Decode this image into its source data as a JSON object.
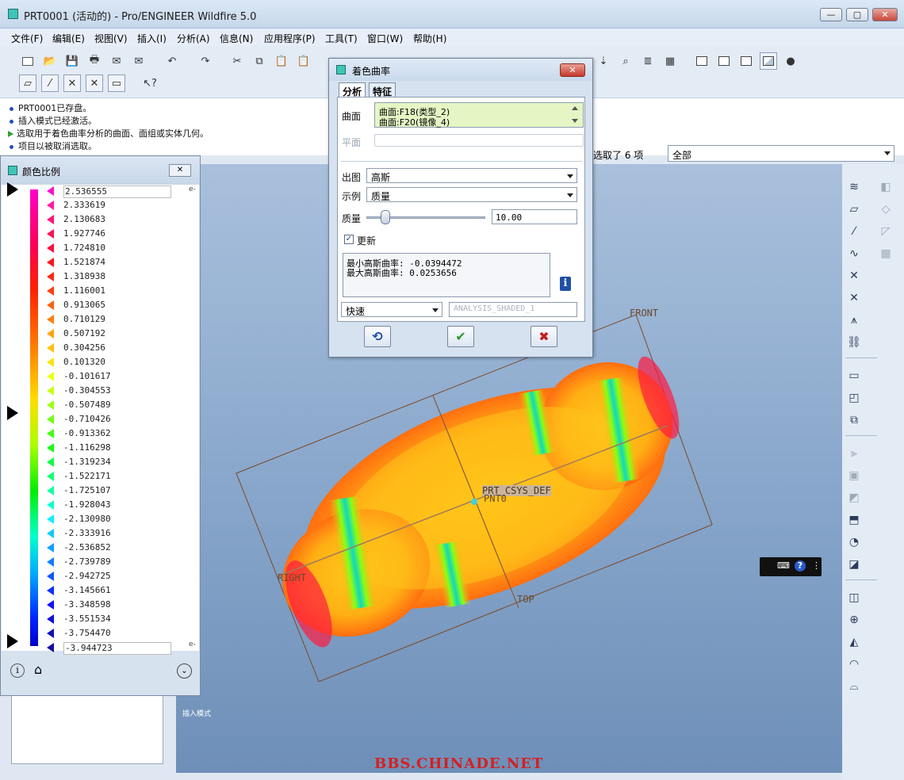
{
  "window": {
    "title": "PRT0001 (活动的) - Pro/ENGINEER Wildfire 5.0",
    "min": "—",
    "max": "▢",
    "close": "✕"
  },
  "menu": [
    "文件(F)",
    "编辑(E)",
    "视图(V)",
    "插入(I)",
    "分析(A)",
    "信息(N)",
    "应用程序(P)",
    "工具(T)",
    "窗口(W)",
    "帮助(H)"
  ],
  "messages": [
    "PRT0001已存盘。",
    "插入模式已经激活。",
    "选取用于着色曲率分析的曲面、面组或实体几何。",
    "项目以被取消选取。"
  ],
  "selection": {
    "label": "选取了 6 项",
    "filter": "全部"
  },
  "scale_window": {
    "title": "颜色比例",
    "exponent_top": "e-",
    "exponent_bottom": "e-",
    "values": [
      "2.536555",
      "2.333619",
      "2.130683",
      "1.927746",
      "1.724810",
      "1.521874",
      "1.318938",
      "1.116001",
      "0.913065",
      "0.710129",
      "0.507192",
      "0.304256",
      "0.101320",
      "-0.101617",
      "-0.304553",
      "-0.507489",
      "-0.710426",
      "-0.913362",
      "-1.116298",
      "-1.319234",
      "-1.522171",
      "-1.725107",
      "-1.928043",
      "-2.130980",
      "-2.333916",
      "-2.536852",
      "-2.739789",
      "-2.942725",
      "-3.145661",
      "-3.348598",
      "-3.551534",
      "-3.754470",
      "-3.944723"
    ],
    "tick_colors": [
      "#ff10c8",
      "#ff1aa0",
      "#ff1478",
      "#ff1050",
      "#ff1038",
      "#ff1520",
      "#ff2a10",
      "#ff4010",
      "#ff6010",
      "#ff8010",
      "#ffa010",
      "#ffc010",
      "#ffe010",
      "#f0ff10",
      "#c8ff10",
      "#a0ff10",
      "#70ff10",
      "#40ff10",
      "#10ff10",
      "#10ff40",
      "#10ff70",
      "#10ffa0",
      "#10ffd0",
      "#10f0ff",
      "#10c8ff",
      "#10a0ff",
      "#1080ff",
      "#1058ff",
      "#1030ff",
      "#1010ff",
      "#1010d8",
      "#1010b8",
      "#1010a0"
    ],
    "foot_info_icon": "i-circle-icon",
    "foot_home_icon": "home-icon",
    "foot_collapse_icon": "chevron-down-circle-icon"
  },
  "dialog": {
    "title": "着色曲率",
    "tabs": [
      "分析",
      "特征"
    ],
    "surface_label": "曲面",
    "surfaces": [
      "曲面:F18(类型_2)",
      "曲面:F20(镜像_4)"
    ],
    "plane_label": "平面",
    "output_label": "出图",
    "output_value": "高斯",
    "display_label": "示例",
    "display_value": "质量",
    "quality_label": "质量",
    "quality_value": "10.00",
    "quality_fraction": 0.1,
    "update_label": "更新",
    "update_checked": "✓",
    "result_lines": [
      "最小高斯曲率: -0.0394472",
      "最大高斯曲率: 0.0253656"
    ],
    "mode_value": "快速",
    "analysis_name": "ANALYSIS_SHADED_1",
    "info_glyph": "i",
    "btn_repeat": "⟲",
    "btn_ok": "✔",
    "btn_cancel": "✖"
  },
  "viewport": {
    "labels": {
      "front": "FRONT",
      "right": "RIGHT",
      "top": "TOP",
      "csys": "PRT_CSYS_DEF",
      "pnt": "PNT0"
    },
    "mode_label": "插入模式",
    "watermark": "BBS.CHINADE.NET",
    "mini_toolbar": {
      "keyboard": "⌨",
      "help": "?",
      "more": "⋮"
    }
  },
  "colors": {
    "accent": "#2050c0",
    "ok": "#2a9a2a",
    "cancel": "#cc1a1a"
  }
}
